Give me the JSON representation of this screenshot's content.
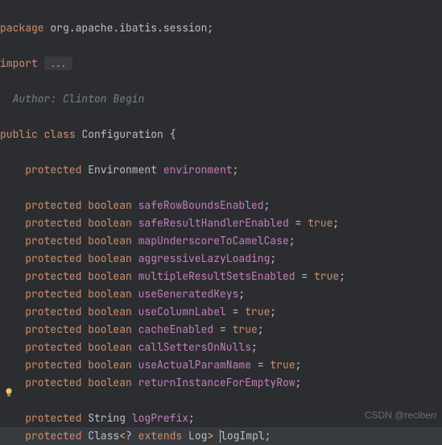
{
  "pkg_kw": "package",
  "pkg_name": " org.apache.ibatis.session;",
  "import_kw": "import",
  "import_fold": "...",
  "author_comment": "Author: Clinton Begin",
  "class_line": {
    "public": "public",
    "class": "class",
    "name": "Configuration",
    "brace": " {"
  },
  "env_line": {
    "protected": "protected",
    "type": " Environment ",
    "name": "environment",
    "end": ";"
  },
  "fields": [
    {
      "protected": "protected",
      "type": " boolean ",
      "name": "safeRowBoundsEnabled",
      "rest": ";"
    },
    {
      "protected": "protected",
      "type": " boolean ",
      "name": "safeResultHandlerEnabled",
      "rest": " = ",
      "lit": "true",
      "end": ";"
    },
    {
      "protected": "protected",
      "type": " boolean ",
      "name": "mapUnderscoreToCamelCase",
      "rest": ";"
    },
    {
      "protected": "protected",
      "type": " boolean ",
      "name": "aggressiveLazyLoading",
      "rest": ";"
    },
    {
      "protected": "protected",
      "type": " boolean ",
      "name": "multipleResultSetsEnabled",
      "rest": " = ",
      "lit": "true",
      "end": ";"
    },
    {
      "protected": "protected",
      "type": " boolean ",
      "name": "useGeneratedKeys",
      "rest": ";"
    },
    {
      "protected": "protected",
      "type": " boolean ",
      "name": "useColumnLabel",
      "rest": " = ",
      "lit": "true",
      "end": ";"
    },
    {
      "protected": "protected",
      "type": " boolean ",
      "name": "cacheEnabled",
      "rest": " = ",
      "lit": "true",
      "end": ";"
    },
    {
      "protected": "protected",
      "type": " boolean ",
      "name": "callSettersOnNulls",
      "rest": ";"
    },
    {
      "protected": "protected",
      "type": " boolean ",
      "name": "useActualParamName",
      "rest": " = ",
      "lit": "true",
      "end": ";"
    },
    {
      "protected": "protected",
      "type": " boolean ",
      "name": "returnInstanceForEmptyRow",
      "rest": ";"
    }
  ],
  "logprefix": {
    "protected": "protected",
    "type": " String ",
    "name": "logPrefix",
    "end": ";"
  },
  "logimpl": {
    "protected": "protected",
    "class": " Class",
    "lt": "<",
    "wild": "? ",
    "extends": "extends",
    "log": " Log",
    "gt": ">",
    "space": " ",
    "name": "logImpl",
    "end": ";"
  },
  "watermark": "CSDN @reciberr"
}
